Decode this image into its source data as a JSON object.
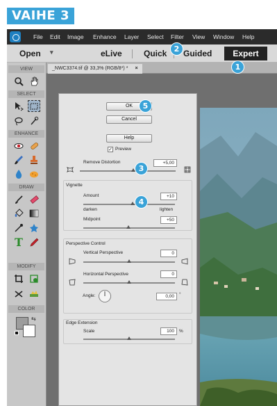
{
  "step_label": "VAIHE 3",
  "menu": [
    "File",
    "Edit",
    "Image",
    "Enhance",
    "Layer",
    "Select",
    "Filter",
    "View",
    "Window",
    "Help"
  ],
  "modes": {
    "open": "Open",
    "elive": "eLive",
    "quick": "Quick",
    "guided": "Guided",
    "expert": "Expert"
  },
  "document_tab": {
    "title": "_NWC3374.tif @ 33,3% (RGB/8*) *",
    "close": "×"
  },
  "toolpanel": {
    "sections": [
      "VIEW",
      "SELECT",
      "ENHANCE",
      "DRAW",
      "MODIFY",
      "COLOR"
    ]
  },
  "dialog": {
    "ok_label": "OK",
    "cancel_label": "Cancel",
    "help_label": "Help",
    "preview_label": "Preview",
    "preview_checked": "✓",
    "remove_distortion_label": "Remove Distortion",
    "remove_distortion_value": "+5,00",
    "vignette_title": "Vignette",
    "amount_label": "Amount",
    "amount_value": "+10",
    "darken_label": "darken",
    "lighten_label": "lighten",
    "midpoint_label": "Midpoint",
    "midpoint_value": "+50",
    "perspective_title": "Perspective Control",
    "vertical_label": "Vertical Perspective",
    "vertical_value": "0",
    "horizontal_label": "Horizontal Perspective",
    "horizontal_value": "0",
    "angle_label": "Angle:",
    "angle_value": "0,00",
    "degree_symbol": "°",
    "edge_title": "Edge Extension",
    "scale_label": "Scale",
    "scale_value": "100",
    "percent_symbol": "%"
  },
  "badges": [
    "1",
    "2",
    "3",
    "4",
    "5"
  ],
  "colors": {
    "accent": "#3aa3d8",
    "menubar": "#2b2b2b",
    "panel": "#c7c7c7"
  }
}
